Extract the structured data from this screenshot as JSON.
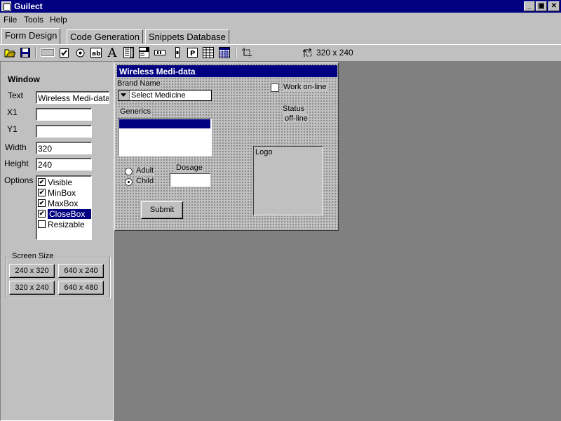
{
  "window": {
    "title": "Guilect"
  },
  "menu": {
    "file": "File",
    "tools": "Tools",
    "help": "Help"
  },
  "tabs": [
    "Form Design",
    "Code Generation",
    "Snippets Database"
  ],
  "toolbar": {
    "icons": [
      "open-icon",
      "save-icon",
      "frame-icon",
      "checkbox-icon",
      "radio-icon",
      "textbox-icon",
      "label-icon",
      "listbox-icon",
      "combobox-icon",
      "hscroll-icon",
      "vscroll-icon",
      "panel-icon",
      "grid-icon",
      "calendar-icon",
      "select-icon"
    ],
    "size_label": "320 x 240"
  },
  "properties": {
    "heading": "Window",
    "text_label": "Text",
    "text_value": "Wireless Medi-data",
    "x1_label": "X1",
    "x1_value": "",
    "y1_label": "Y1",
    "y1_value": "",
    "width_label": "Width",
    "width_value": "320",
    "height_label": "Height",
    "height_value": "240",
    "options_label": "Options",
    "options": [
      {
        "label": "Visible",
        "checked": true
      },
      {
        "label": "MinBox",
        "checked": true
      },
      {
        "label": "MaxBox",
        "checked": true
      },
      {
        "label": "CloseBox",
        "checked": true,
        "selected": true
      },
      {
        "label": "Resizable",
        "checked": false
      }
    ]
  },
  "screen_size": {
    "title": "Screen Size",
    "buttons": [
      "240 x 320",
      "640 x 240",
      "320 x 240",
      "640 x 480"
    ]
  },
  "form": {
    "title": "Wireless Medi-data",
    "brand_label": "Brand Name",
    "brand_value": "Select Medicine",
    "work_online_label": "Work on-line",
    "work_online_checked": false,
    "status_label": "Status",
    "status_value": "off-line",
    "generics_label": "Generics",
    "logo_label": "Logo",
    "dosage_label": "Dosage",
    "adult_label": "Adult",
    "child_label": "Child",
    "selected_radio": "Child",
    "submit_label": "Submit"
  }
}
